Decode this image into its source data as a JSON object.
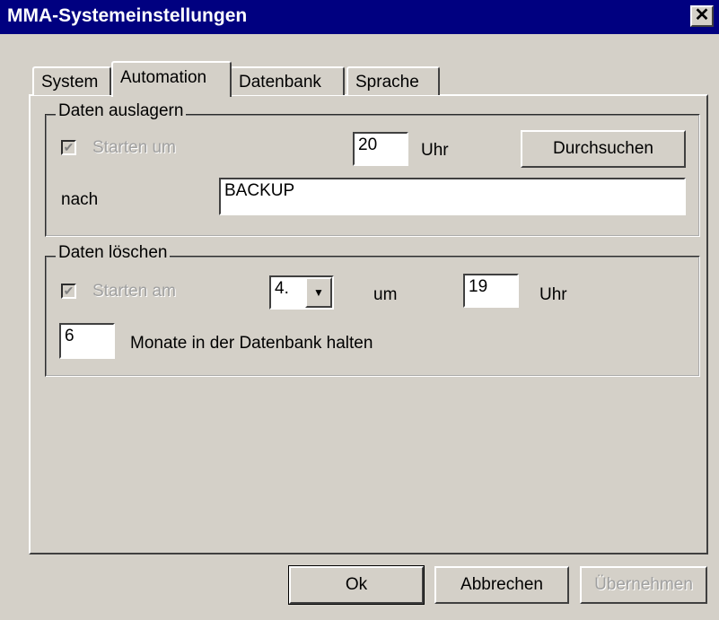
{
  "window": {
    "title": "MMA-Systemeinstellungen",
    "close_glyph": "✕"
  },
  "tabs": [
    {
      "label": "System",
      "active": false
    },
    {
      "label": "Automation",
      "active": true
    },
    {
      "label": "Datenbank",
      "active": false
    },
    {
      "label": "Sprache",
      "active": false
    }
  ],
  "archive_group": {
    "label": "Daten auslagern",
    "start_checkbox_label": "Starten um",
    "start_checked": true,
    "hour_value": "20",
    "hour_unit": "Uhr",
    "browse_label": "Durchsuchen",
    "target_label": "nach",
    "target_value": "BACKUP"
  },
  "delete_group": {
    "label": "Daten löschen",
    "start_checkbox_label": "Starten am",
    "start_checked": true,
    "day_value": "4.",
    "at_label": "um",
    "hour_value": "19",
    "hour_unit": "Uhr",
    "months_value": "6",
    "months_label": "Monate in der Datenbank halten"
  },
  "footer": {
    "ok_label": "Ok",
    "cancel_label": "Abbrechen",
    "apply_label": "Übernehmen"
  }
}
